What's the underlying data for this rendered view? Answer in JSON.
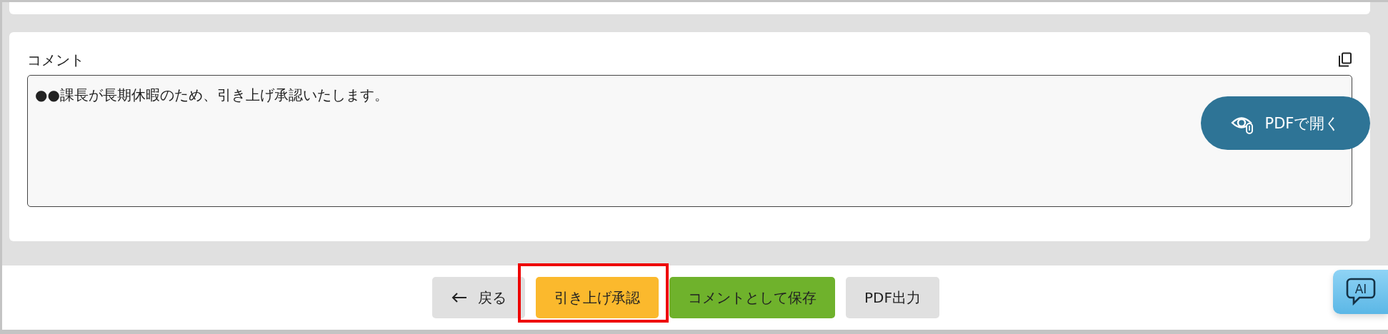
{
  "comment": {
    "label": "コメント",
    "value": "●●課長が長期休暇のため、引き上げ承認いたします。"
  },
  "pdf_open_button": {
    "label": "PDFで開く"
  },
  "actions": [
    {
      "kind": "back",
      "label": "戻る",
      "highlighted": false
    },
    {
      "kind": "approve",
      "label": "引き上げ承認",
      "highlighted": true
    },
    {
      "kind": "save",
      "label": "コメントとして保存",
      "highlighted": false
    },
    {
      "kind": "pdf",
      "label": "PDF出力",
      "highlighted": false
    }
  ],
  "ai_button": {
    "label": "AI"
  }
}
